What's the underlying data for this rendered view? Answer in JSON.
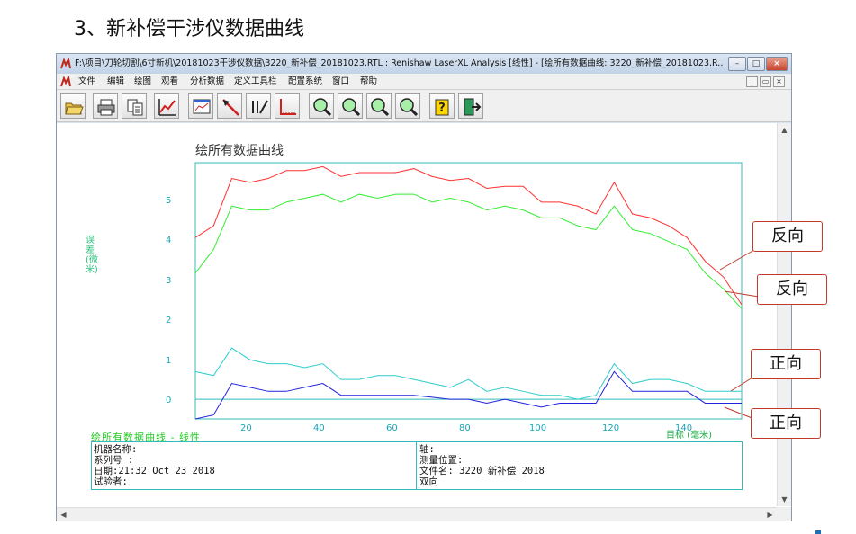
{
  "slide": {
    "title": "3、新补偿干涉仪数据曲线"
  },
  "window": {
    "title": "F:\\项目\\刀轮切割\\6寸新机\\20181023干涉仪数据\\3220_新补偿_20181023.RTL : Renishaw LaserXL Analysis [线性] - [绘所有数据曲线: 3220_新补偿_20181023.R...",
    "controls": {
      "minimize": "–",
      "maximize": "□",
      "close": "×"
    }
  },
  "menu": {
    "items": [
      "文件",
      "编辑",
      "绘图",
      "观看",
      "分析数据",
      "定义工具栏",
      "配置系统",
      "窗口",
      "帮助"
    ],
    "mdi": {
      "minimize": "_",
      "restore": "▭",
      "close": "×"
    }
  },
  "toolbar": {
    "icons": [
      "open-folder-icon",
      "print-icon",
      "copy-icon",
      "chart-line-icon",
      "plot-window-icon",
      "cursor-icon",
      "slope-icon",
      "axis-icon",
      "zoom-x-icon",
      "zoom-y-icon",
      "zoom-in-icon",
      "zoom-out-icon",
      "help-icon",
      "exit-icon"
    ]
  },
  "chart": {
    "title": "绘所有数据曲线",
    "ylabel": "误差 (微米)",
    "xlabel": "目标 (毫米)",
    "yticks": [
      "5",
      "4",
      "3",
      "2",
      "1",
      "0"
    ],
    "xticks": [
      "20",
      "40",
      "60",
      "80",
      "100",
      "120",
      "140"
    ],
    "footer_title": "绘所有数据曲线 - 线性"
  },
  "chart_data": {
    "type": "line",
    "xlabel": "目标 (毫米)",
    "ylabel": "误差 (微米)",
    "xlim": [
      0,
      150
    ],
    "ylim": [
      -0.5,
      6
    ],
    "series": [
      {
        "name": "反向",
        "color": "#ff3030",
        "x": [
          0,
          5,
          10,
          15,
          20,
          25,
          30,
          35,
          40,
          45,
          50,
          55,
          60,
          65,
          70,
          75,
          80,
          85,
          90,
          95,
          100,
          105,
          110,
          115,
          120,
          125,
          130,
          135,
          140,
          145,
          150
        ],
        "values": [
          4.1,
          4.4,
          5.6,
          5.5,
          5.6,
          5.8,
          5.8,
          5.9,
          5.65,
          5.75,
          5.75,
          5.75,
          5.85,
          5.65,
          5.55,
          5.6,
          5.35,
          5.4,
          5.4,
          5.0,
          5.0,
          4.9,
          4.7,
          5.5,
          4.7,
          4.6,
          4.4,
          4.1,
          3.5,
          3.1,
          2.4
        ]
      },
      {
        "name": "反向",
        "color": "#33ee33",
        "x": [
          0,
          5,
          10,
          15,
          20,
          25,
          30,
          35,
          40,
          45,
          50,
          55,
          60,
          65,
          70,
          75,
          80,
          85,
          90,
          95,
          100,
          105,
          110,
          115,
          120,
          125,
          130,
          135,
          140,
          145,
          150
        ],
        "values": [
          3.2,
          3.8,
          4.9,
          4.8,
          4.8,
          5.0,
          5.1,
          5.2,
          5.0,
          5.2,
          5.1,
          5.2,
          5.2,
          5.0,
          5.1,
          5.0,
          4.8,
          4.9,
          4.8,
          4.6,
          4.6,
          4.4,
          4.3,
          4.9,
          4.3,
          4.2,
          4.0,
          3.8,
          3.2,
          2.8,
          2.3
        ]
      },
      {
        "name": "正向",
        "color": "#2ecccc",
        "x": [
          0,
          5,
          10,
          15,
          20,
          25,
          30,
          35,
          40,
          45,
          50,
          55,
          60,
          65,
          70,
          75,
          80,
          85,
          90,
          95,
          100,
          105,
          110,
          115,
          120,
          125,
          130,
          135,
          140,
          145,
          150
        ],
        "values": [
          0.7,
          0.6,
          1.3,
          1.0,
          0.9,
          0.9,
          0.8,
          0.9,
          0.5,
          0.5,
          0.6,
          0.6,
          0.5,
          0.4,
          0.3,
          0.5,
          0.2,
          0.3,
          0.2,
          0.1,
          0.1,
          0.0,
          0.1,
          0.9,
          0.4,
          0.5,
          0.5,
          0.4,
          0.2,
          0.2,
          0.2
        ]
      },
      {
        "name": "正向",
        "color": "#2222dd",
        "x": [
          0,
          5,
          10,
          15,
          20,
          25,
          30,
          35,
          40,
          45,
          50,
          55,
          60,
          65,
          70,
          75,
          80,
          85,
          90,
          95,
          100,
          105,
          110,
          115,
          120,
          125,
          130,
          135,
          140,
          145,
          150
        ],
        "values": [
          -0.5,
          -0.4,
          0.4,
          0.3,
          0.2,
          0.2,
          0.3,
          0.4,
          0.1,
          0.1,
          0.1,
          0.1,
          0.1,
          0.05,
          0.0,
          0.0,
          -0.1,
          0.0,
          -0.1,
          -0.2,
          -0.1,
          -0.1,
          -0.1,
          0.7,
          0.2,
          0.2,
          0.2,
          0.2,
          -0.1,
          -0.1,
          -0.1
        ]
      }
    ],
    "axis_line_y": 0,
    "grid": false
  },
  "info": {
    "left": [
      "机器名称:",
      "系列号  :",
      "日期:21:32 Oct 23 2018",
      "试验者:"
    ],
    "right": [
      "轴:",
      "测量位置:",
      "文件名: 3220_新补偿_2018",
      "双向"
    ]
  },
  "callouts": [
    "反向",
    "反向",
    "正向",
    "正向"
  ]
}
